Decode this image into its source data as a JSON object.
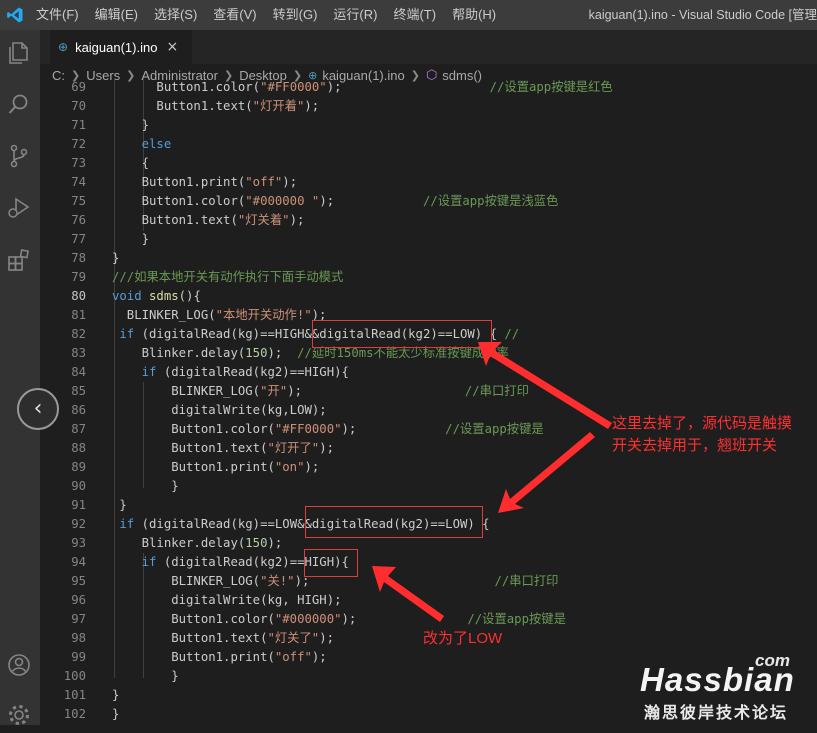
{
  "menu": [
    "文件(F)",
    "编辑(E)",
    "选择(S)",
    "查看(V)",
    "转到(G)",
    "运行(R)",
    "终端(T)",
    "帮助(H)"
  ],
  "window_title": "kaiguan(1).ino - Visual Studio Code [管理",
  "tab": {
    "label": "kaiguan(1).ino",
    "close": "×"
  },
  "breadcrumb": [
    "C:",
    "Users",
    "Administrator",
    "Desktop",
    "kaiguan(1).ino",
    "sdms()"
  ],
  "code_lines": [
    {
      "n": "69",
      "parts": [
        {
          "t": "      Button1.color(",
          "c": ""
        },
        {
          "t": "\"#FF0000\"",
          "c": "s"
        },
        {
          "t": ");                    ",
          "c": ""
        },
        {
          "t": "//设置app按键是红色",
          "c": "c"
        }
      ]
    },
    {
      "n": "70",
      "parts": [
        {
          "t": "      Button1.text(",
          "c": ""
        },
        {
          "t": "\"灯开着\"",
          "c": "s"
        },
        {
          "t": ");",
          "c": ""
        }
      ]
    },
    {
      "n": "71",
      "parts": [
        {
          "t": "    }",
          "c": ""
        }
      ]
    },
    {
      "n": "72",
      "parts": [
        {
          "t": "    ",
          "c": ""
        },
        {
          "t": "else",
          "c": "k"
        }
      ]
    },
    {
      "n": "73",
      "parts": [
        {
          "t": "    {",
          "c": ""
        }
      ]
    },
    {
      "n": "74",
      "parts": [
        {
          "t": "    Button1.print(",
          "c": ""
        },
        {
          "t": "\"off\"",
          "c": "s"
        },
        {
          "t": ");",
          "c": ""
        }
      ]
    },
    {
      "n": "75",
      "parts": [
        {
          "t": "    Button1.color(",
          "c": ""
        },
        {
          "t": "\"#000000 \"",
          "c": "s"
        },
        {
          "t": ");            ",
          "c": ""
        },
        {
          "t": "//设置app按键是浅蓝色",
          "c": "c"
        }
      ]
    },
    {
      "n": "76",
      "parts": [
        {
          "t": "    Button1.text(",
          "c": ""
        },
        {
          "t": "\"灯关着\"",
          "c": "s"
        },
        {
          "t": ");",
          "c": ""
        }
      ]
    },
    {
      "n": "77",
      "parts": [
        {
          "t": "    }",
          "c": ""
        }
      ]
    },
    {
      "n": "78",
      "parts": [
        {
          "t": "}",
          "c": ""
        }
      ]
    },
    {
      "n": "79",
      "parts": [
        {
          "t": "///如果本地开关有动作执行下面手动模式",
          "c": "c"
        }
      ]
    },
    {
      "n": "80",
      "parts": [
        {
          "t": "void",
          "c": "k"
        },
        {
          "t": " ",
          "c": ""
        },
        {
          "t": "sdms",
          "c": "f"
        },
        {
          "t": "(){",
          "c": ""
        }
      ],
      "current": true
    },
    {
      "n": "81",
      "parts": [
        {
          "t": "  BLINKER_LOG(",
          "c": ""
        },
        {
          "t": "\"本地开关动作!\"",
          "c": "s"
        },
        {
          "t": ");",
          "c": ""
        }
      ]
    },
    {
      "n": "82",
      "parts": [
        {
          "t": " ",
          "c": ""
        },
        {
          "t": "if",
          "c": "k"
        },
        {
          "t": " (digitalRead(kg)==HIGH&&digitalRead(kg2)==LOW) { ",
          "c": ""
        },
        {
          "t": "//",
          "c": "c"
        }
      ]
    },
    {
      "n": "83",
      "parts": [
        {
          "t": "    Blinker.delay(",
          "c": ""
        },
        {
          "t": "150",
          "c": "n"
        },
        {
          "t": ");  ",
          "c": ""
        },
        {
          "t": "//延时150ms不能太少标准按键成功率",
          "c": "c"
        }
      ]
    },
    {
      "n": "84",
      "parts": [
        {
          "t": "    ",
          "c": ""
        },
        {
          "t": "if",
          "c": "k"
        },
        {
          "t": " (digitalRead(kg2)==HIGH){",
          "c": ""
        }
      ]
    },
    {
      "n": "85",
      "parts": [
        {
          "t": "        BLINKER_LOG(",
          "c": ""
        },
        {
          "t": "\"开\"",
          "c": "s"
        },
        {
          "t": ");                      ",
          "c": ""
        },
        {
          "t": "//串口打印",
          "c": "c"
        }
      ]
    },
    {
      "n": "86",
      "parts": [
        {
          "t": "        digitalWrite(kg,LOW);",
          "c": ""
        }
      ]
    },
    {
      "n": "87",
      "parts": [
        {
          "t": "        Button1.color(",
          "c": ""
        },
        {
          "t": "\"#FF0000\"",
          "c": "s"
        },
        {
          "t": ");            ",
          "c": ""
        },
        {
          "t": "//设置app按键是",
          "c": "c"
        }
      ]
    },
    {
      "n": "88",
      "parts": [
        {
          "t": "        Button1.text(",
          "c": ""
        },
        {
          "t": "\"灯开了\"",
          "c": "s"
        },
        {
          "t": ");",
          "c": ""
        }
      ]
    },
    {
      "n": "89",
      "parts": [
        {
          "t": "        Button1.print(",
          "c": ""
        },
        {
          "t": "\"on\"",
          "c": "s"
        },
        {
          "t": ");",
          "c": ""
        }
      ]
    },
    {
      "n": "90",
      "parts": [
        {
          "t": "        }",
          "c": ""
        }
      ]
    },
    {
      "n": "91",
      "parts": [
        {
          "t": " }",
          "c": ""
        }
      ]
    },
    {
      "n": "92",
      "parts": [
        {
          "t": " ",
          "c": ""
        },
        {
          "t": "if",
          "c": "k"
        },
        {
          "t": " (digitalRead(kg)==LOW&&digitalRead(kg2)==LOW) {",
          "c": ""
        }
      ]
    },
    {
      "n": "93",
      "parts": [
        {
          "t": "    Blinker.delay(",
          "c": ""
        },
        {
          "t": "150",
          "c": "n"
        },
        {
          "t": ");",
          "c": ""
        }
      ]
    },
    {
      "n": "94",
      "parts": [
        {
          "t": "    ",
          "c": ""
        },
        {
          "t": "if",
          "c": "k"
        },
        {
          "t": " (digitalRead(kg2)==HIGH){",
          "c": ""
        }
      ]
    },
    {
      "n": "95",
      "parts": [
        {
          "t": "        BLINKER_LOG(",
          "c": ""
        },
        {
          "t": "\"关!\"",
          "c": "s"
        },
        {
          "t": ");                         ",
          "c": ""
        },
        {
          "t": "//串口打印",
          "c": "c"
        }
      ]
    },
    {
      "n": "96",
      "parts": [
        {
          "t": "        digitalWrite(kg, HIGH);",
          "c": ""
        }
      ]
    },
    {
      "n": "97",
      "parts": [
        {
          "t": "        Button1.color(",
          "c": ""
        },
        {
          "t": "\"#000000\"",
          "c": "s"
        },
        {
          "t": ");               ",
          "c": ""
        },
        {
          "t": "//设置app按键是",
          "c": "c"
        }
      ]
    },
    {
      "n": "98",
      "parts": [
        {
          "t": "        Button1.text(",
          "c": ""
        },
        {
          "t": "\"灯关了\"",
          "c": "s"
        },
        {
          "t": ");",
          "c": ""
        }
      ]
    },
    {
      "n": "99",
      "parts": [
        {
          "t": "        Button1.print(",
          "c": ""
        },
        {
          "t": "\"off\"",
          "c": "s"
        },
        {
          "t": ");",
          "c": ""
        }
      ]
    },
    {
      "n": "100",
      "parts": [
        {
          "t": "        }",
          "c": ""
        }
      ]
    },
    {
      "n": "101",
      "parts": [
        {
          "t": "}",
          "c": ""
        }
      ]
    },
    {
      "n": "102",
      "parts": [
        {
          "t": "}",
          "c": ""
        }
      ]
    }
  ],
  "annotations": {
    "note1_line1": "这里去掉了，源代码是触摸",
    "note1_line2": "开关去掉用于，翘班开关",
    "note2": "改为了LOW"
  },
  "watermark": {
    "com": "com",
    "brand": "Hassbian",
    "sub": "瀚思彼岸技术论坛"
  },
  "colors": {
    "accent": "#007acc",
    "annotation": "#ff3030"
  }
}
